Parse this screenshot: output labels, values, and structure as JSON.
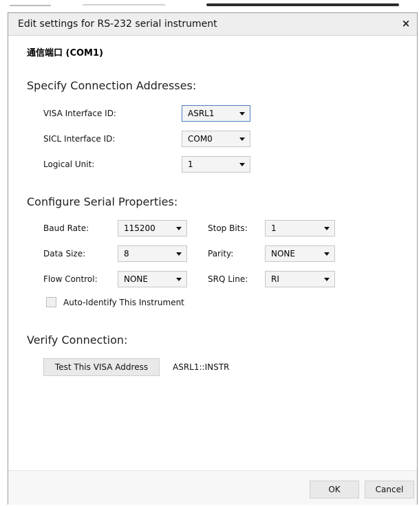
{
  "dialog": {
    "title": "Edit settings for RS-232 serial instrument",
    "close_label": "×",
    "port_heading": "通信端口 (COM1)"
  },
  "connection": {
    "section_title": "Specify Connection Addresses:",
    "visa_label": "VISA Interface ID:",
    "visa_value": "ASRL1",
    "sicl_label": "SICL Interface ID:",
    "sicl_value": "COM0",
    "lu_label": "Logical Unit:",
    "lu_value": "1"
  },
  "serial": {
    "section_title": "Configure Serial Properties:",
    "baud_label": "Baud Rate:",
    "baud_value": "115200",
    "stop_label": "Stop Bits:",
    "stop_value": "1",
    "data_label": "Data Size:",
    "data_value": "8",
    "parity_label": "Parity:",
    "parity_value": "NONE",
    "flow_label": "Flow Control:",
    "flow_value": "NONE",
    "srq_label": "SRQ Line:",
    "srq_value": "RI",
    "auto_identify_label": "Auto-Identify This Instrument",
    "auto_identify_checked": false
  },
  "verify": {
    "section_title": "Verify Connection:",
    "test_button_label": "Test This VISA Address",
    "address": "ASRL1::INSTR"
  },
  "footer": {
    "ok_label": "OK",
    "cancel_label": "Cancel"
  }
}
